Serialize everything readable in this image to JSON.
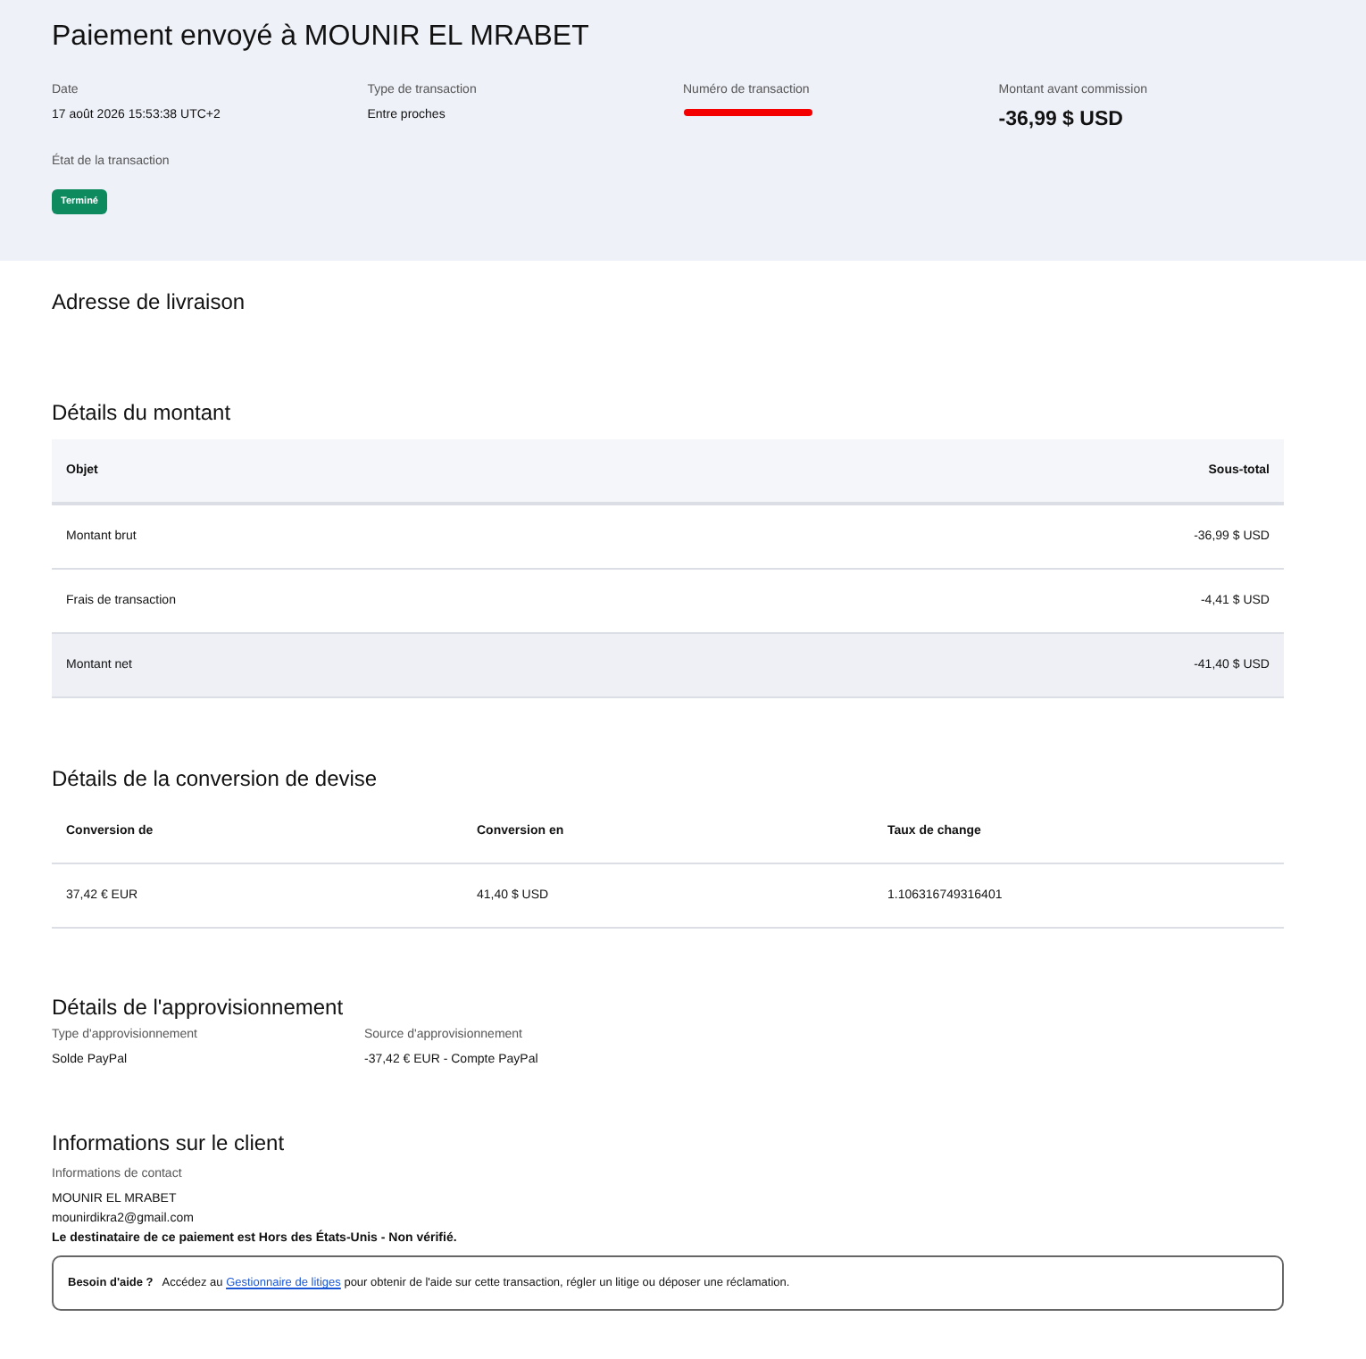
{
  "title": "Paiement envoyé à MOUNIR EL MRABET",
  "summary": [
    {
      "label": "Date",
      "value": "17 août 2026 15:53:38 UTC+2",
      "kind": "text"
    },
    {
      "label": "Type de transaction",
      "value": "Entre proches",
      "kind": "text"
    },
    {
      "label": "Numéro de transaction",
      "kind": "redacted"
    },
    {
      "label": "Montant avant commission",
      "value": "-36,99 $ USD",
      "kind": "amount"
    }
  ],
  "status": {
    "label": "État de la transaction",
    "badge": "Terminé",
    "color": "#0e8a5f"
  },
  "shipping": {
    "heading": "Adresse de livraison"
  },
  "amount_details": {
    "heading": "Détails du montant",
    "columns": [
      "Objet",
      "Sous-total"
    ],
    "rows": [
      {
        "item": "Montant brut",
        "subtotal": "-36,99 $ USD",
        "shaded": false
      },
      {
        "item": "Frais de transaction",
        "subtotal": "-4,41 $ USD",
        "shaded": false
      },
      {
        "item": "Montant net",
        "subtotal": "-41,40 $ USD",
        "shaded": true
      }
    ]
  },
  "conversion": {
    "heading": "Détails de la conversion de devise",
    "columns": [
      "Conversion de",
      "Conversion en",
      "Taux de change"
    ],
    "rows": [
      [
        "37,42 € EUR",
        "41,40 $ USD",
        "1.106316749316401"
      ]
    ]
  },
  "funding": {
    "heading": "Détails de l'approvisionnement",
    "fields": [
      {
        "label": "Type d'approvisionnement",
        "value": "Solde PayPal"
      },
      {
        "label": "Source d'approvisionnement",
        "value": "-37,42 € EUR - Compte PayPal"
      }
    ]
  },
  "customer": {
    "heading": "Informations sur le client",
    "subheading": "Informations de contact",
    "name": "MOUNIR EL MRABET",
    "email": "mounirdikra2@gmail.com",
    "notice": "Le destinataire de ce paiement est Hors des États-Unis - Non vérifié."
  },
  "help": {
    "label": "Besoin d'aide ?",
    "before": "Accédez au",
    "link": "Gestionnaire de litiges",
    "after": "pour obtenir de l'aide sur cette transaction, régler un litige ou déposer une réclamation."
  }
}
